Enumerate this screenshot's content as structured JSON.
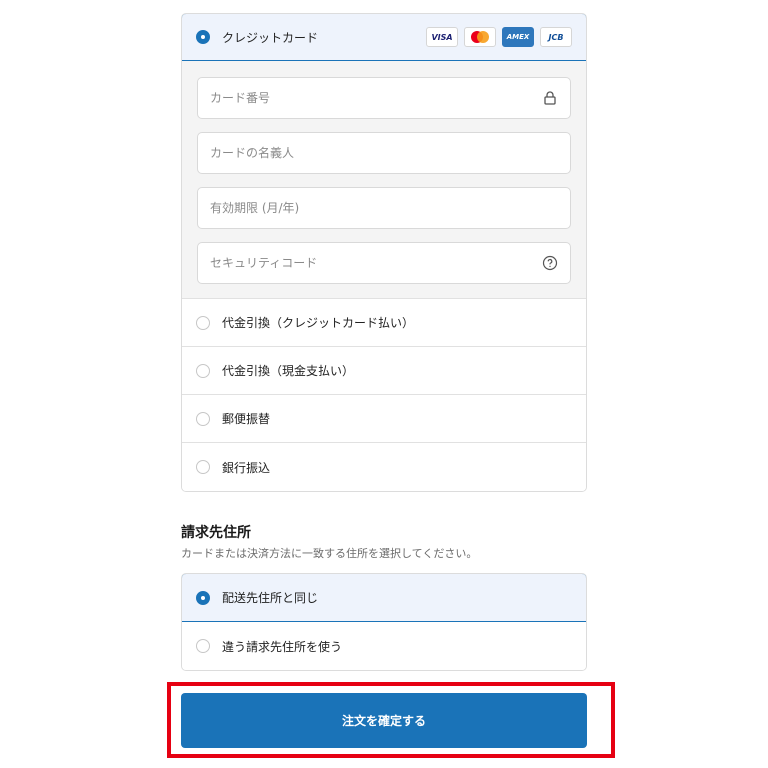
{
  "payment": {
    "credit_card_label": "クレジットカード",
    "card_brands": [
      "VISA",
      "Mastercard",
      "AMEX",
      "JCB"
    ],
    "fields": {
      "card_number_placeholder": "カード番号",
      "card_name_placeholder": "カードの名義人",
      "expiry_placeholder": "有効期限 (月/年)",
      "security_code_placeholder": "セキュリティコード"
    },
    "options": [
      "代金引換（クレジットカード払い）",
      "代金引換（現金支払い）",
      "郵便振替",
      "銀行振込"
    ]
  },
  "billing": {
    "title": "請求先住所",
    "description": "カードまたは決済方法に一致する住所を選択してください。",
    "options": [
      "配送先住所と同じ",
      "違う請求先住所を使う"
    ]
  },
  "confirm_label": "注文を確定する",
  "colors": {
    "accent": "#1a73b8",
    "selected_bg": "#eef3fc",
    "highlight_outline": "#e60012"
  }
}
